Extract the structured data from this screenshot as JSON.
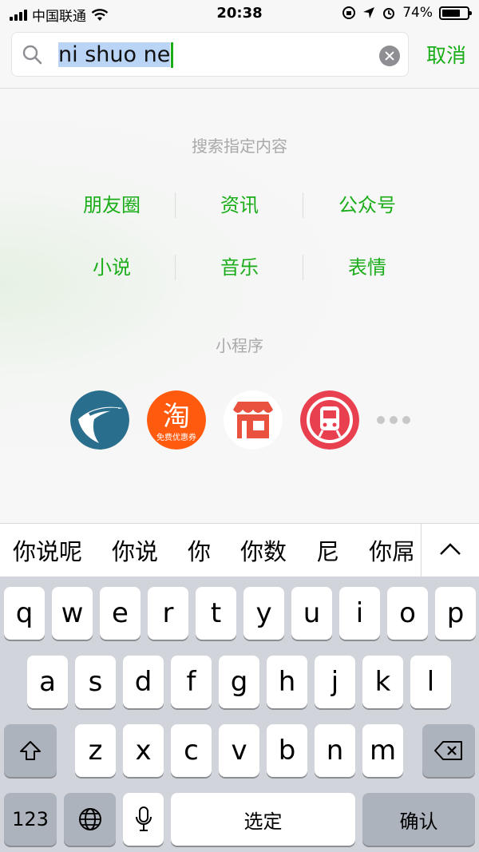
{
  "status": {
    "carrier": "中国联通",
    "time": "20:38",
    "battery": "74%",
    "battery_level": 0.74
  },
  "search": {
    "query_selected": "ni shuo ne",
    "clear_icon": "clear-icon",
    "cancel_label": "取消"
  },
  "sections": {
    "specify_title": "搜索指定内容",
    "categories": [
      "朋友圈",
      "资讯",
      "公众号",
      "小说",
      "音乐",
      "表情"
    ],
    "miniprogram_title": "小程序"
  },
  "mini_apps": [
    {
      "icon": "t-logo-icon"
    },
    {
      "icon": "taobao-icon",
      "glyph": "淘",
      "caption": "免费优惠券"
    },
    {
      "icon": "shop-icon"
    },
    {
      "icon": "metro-icon"
    }
  ],
  "candidates": [
    "你说呢",
    "你说",
    "你",
    "你数",
    "尼",
    "你屌"
  ],
  "keyboard": {
    "row1": [
      "q",
      "w",
      "e",
      "r",
      "t",
      "y",
      "u",
      "i",
      "o",
      "p"
    ],
    "row2": [
      "a",
      "s",
      "d",
      "f",
      "g",
      "h",
      "j",
      "k",
      "l"
    ],
    "row3": [
      "z",
      "x",
      "c",
      "v",
      "b",
      "n",
      "m"
    ],
    "numbers_label": "123",
    "space_label": "选定",
    "confirm_label": "确认"
  },
  "colors": {
    "accent": "#1aad19",
    "keyboard_bg": "#d1d4da"
  }
}
